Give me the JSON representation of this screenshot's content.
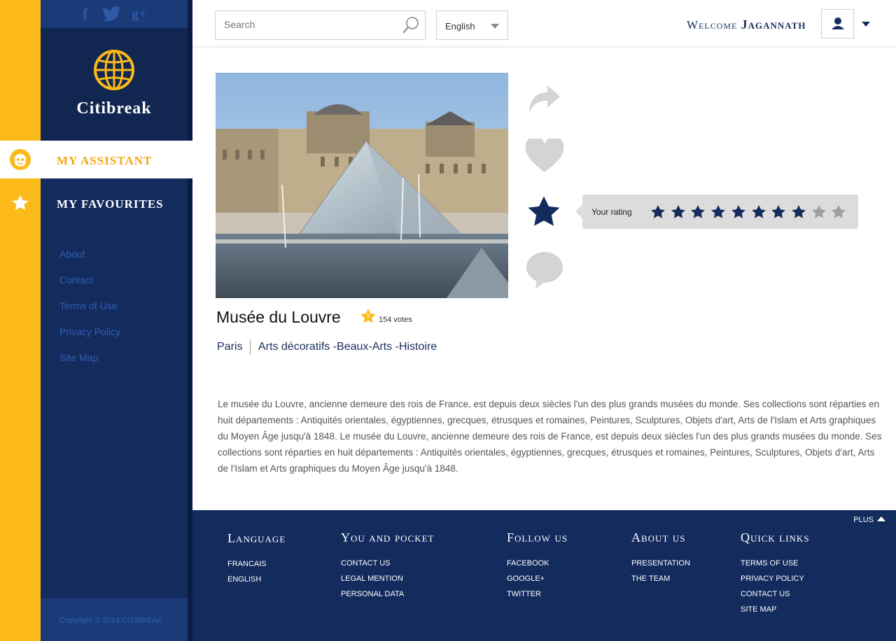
{
  "sidebar": {
    "social": [
      "f",
      "t",
      "g+"
    ],
    "brand": "Citibreak",
    "nav": [
      {
        "label": "MY ASSISTANT"
      },
      {
        "label": "MY FAVOURITES"
      }
    ],
    "links": [
      "About",
      "Contact",
      "Terms of Use",
      "Privacy Policy",
      "Site Map"
    ],
    "copyright": "Copyright © 2014  CITIBREAK"
  },
  "header": {
    "search_placeholder": "Search",
    "language": "English",
    "welcome_prefix": "Welcome",
    "welcome_name": "Jagannath"
  },
  "place": {
    "title": "Musée du Louvre",
    "score": "9",
    "votes": "154 votes",
    "city": "Paris",
    "categories": "Arts décoratifs -Beaux-Arts -Histoire",
    "rating_label": "Your rating",
    "user_rating": 8,
    "rating_max": 10,
    "description": "Le musée du Louvre, ancienne demeure des rois de France, est depuis deux siècles l'un des plus grands musées du monde. Ses collections sont réparties en huit départements : Antiquités orientales, égyptiennes, grecques, étrusques et romaines, Peintures, Sculptures, Objets d'art, Arts de l'Islam et Arts graphiques du Moyen Âge jusqu'à 1848. Le musée du Louvre, ancienne demeure des rois de France, est depuis deux siècles l'un des plus grands musées du monde. Ses collections sont réparties en huit départements : Antiquités orientales, égyptiennes, grecques, étrusques et romaines, Peintures, Sculptures, Objets d'art, Arts de l'Islam et Arts graphiques du Moyen Âge jusqu'à 1848."
  },
  "colors": {
    "navy": "#142b5e",
    "yellow": "#fbb91a",
    "star_on": "#142b5e",
    "star_off": "#9e9e9e"
  },
  "footer": {
    "plus": "PLUS",
    "columns": [
      {
        "title": "Language",
        "links": [
          "FRANCAIS",
          "ENGLISH"
        ]
      },
      {
        "title": "You and pocket",
        "links": [
          "CONTACT US",
          "LEGAL MENTION",
          "PERSONAL DATA"
        ]
      },
      {
        "title": "Follow us",
        "links": [
          "FACEBOOK",
          "GOOGLE+",
          "TWITTER"
        ]
      },
      {
        "title": "About us",
        "links": [
          "PRESENTATION",
          "THE TEAM"
        ]
      },
      {
        "title": "Quick links",
        "links": [
          "TERMS OF USE",
          "PRIVACY POLICY",
          "CONTACT US",
          "SITE MAP"
        ]
      }
    ]
  }
}
